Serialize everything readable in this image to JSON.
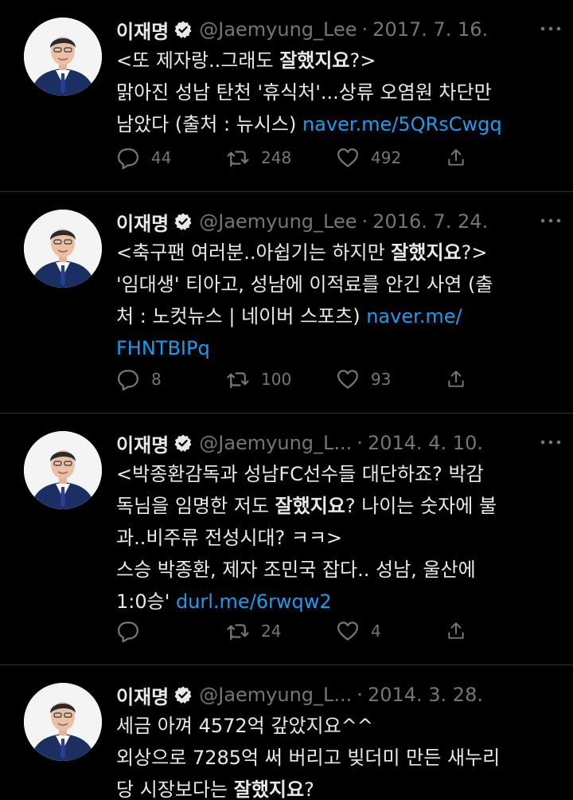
{
  "tweets": [
    {
      "name": "이재명",
      "handle": "@Jaemyung_Lee",
      "date": "2017. 7. 16.",
      "lines": [
        [
          {
            "t": "<또 제자랑..그래도 "
          },
          {
            "t": "잘했지요",
            "b": true
          },
          {
            "t": "?>"
          }
        ],
        [
          {
            "t": "맑아진 성남 탄천 '휴식처'...상류 오염원 차단만"
          }
        ],
        [
          {
            "t": "남았다 (출처 : 뉴시스) "
          },
          {
            "t": "naver.me/5QRsCwgq",
            "link": true
          }
        ]
      ],
      "replies": "44",
      "retweets": "248",
      "likes": "492"
    },
    {
      "name": "이재명",
      "handle": "@Jaemyung_Lee",
      "date": "2016. 7. 24.",
      "lines": [
        [
          {
            "t": "<축구팬 여러분..아쉽기는 하지만 "
          },
          {
            "t": "잘했지요",
            "b": true
          },
          {
            "t": "?>"
          }
        ],
        [
          {
            "t": "'임대생' 티아고, 성남에 이적료를 안긴 사연 (출"
          }
        ],
        [
          {
            "t": "처 : 노컷뉴스 | 네이버 스포츠) "
          },
          {
            "t": "naver.me/",
            "link": true
          }
        ],
        [
          {
            "t": "FHNTBIPq",
            "link": true
          }
        ]
      ],
      "replies": "8",
      "retweets": "100",
      "likes": "93"
    },
    {
      "name": "이재명",
      "handle": "@Jaemyung_L...",
      "date": "2014. 4. 10.",
      "lines": [
        [
          {
            "t": "<박종환감독과  성남FC선수들 대단하죠? 박감"
          }
        ],
        [
          {
            "t": "독님을 임명한 저도 "
          },
          {
            "t": "잘했지요",
            "b": true
          },
          {
            "t": "? 나이는 숫자에 불"
          }
        ],
        [
          {
            "t": "과..비주류 전성시대? ㅋㅋ>"
          }
        ],
        [
          {
            "t": "스승 박종환, 제자 조민국 잡다.. 성남, 울산에"
          }
        ],
        [
          {
            "t": "1:0승' "
          },
          {
            "t": "durl.me/6rwqw2",
            "link": true
          }
        ]
      ],
      "replies": "",
      "retweets": "24",
      "likes": "4"
    },
    {
      "name": "이재명",
      "handle": "@Jaemyung_L...",
      "date": "2014. 3. 28.",
      "lines": [
        [
          {
            "t": "세금 아껴 4572억 갚았지요^^"
          }
        ],
        [
          {
            "t": "외상으로 7285억 써 버리고 빚더미 만든 새누리"
          }
        ],
        [
          {
            "t": "당 시장보다는 "
          },
          {
            "t": "잘했지요",
            "b": true
          },
          {
            "t": "?"
          }
        ]
      ],
      "replies": null,
      "retweets": null,
      "likes": null
    }
  ],
  "colors": {
    "background": "#000000",
    "text": "#e7e9ea",
    "muted": "#71767b",
    "link": "#1d9bf0",
    "divider": "#2f3336"
  },
  "icons": [
    "verified-badge-icon",
    "more-icon",
    "reply-icon",
    "retweet-icon",
    "like-icon",
    "share-icon"
  ]
}
